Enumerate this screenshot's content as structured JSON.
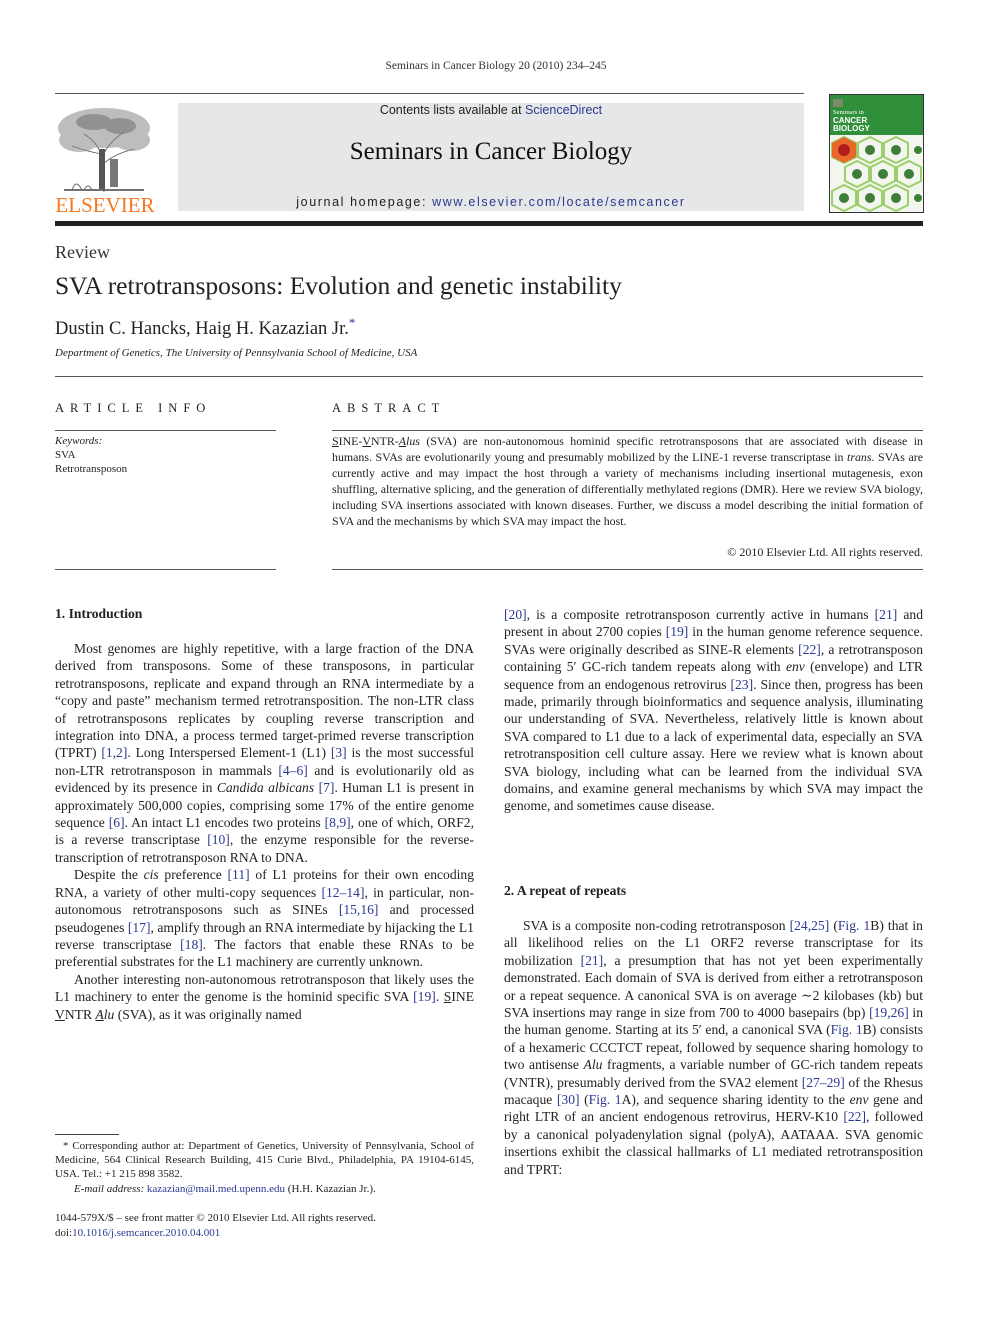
{
  "header": {
    "running_head": "Seminars in Cancer Biology 20 (2010) 234–245",
    "publisher_logo_text": "ELSEVIER",
    "contents_prefix": "Contents lists available at ",
    "contents_link": "ScienceDirect",
    "journal_name": "Seminars in Cancer Biology",
    "homepage_prefix": "journal homepage: ",
    "homepage_link": "www.elsevier.com/locate/semcancer",
    "cover": {
      "line1": "Seminars in",
      "line2": "CANCER",
      "line3": "BIOLOGY"
    }
  },
  "article": {
    "type": "Review",
    "title": "SVA retrotransposons: Evolution and genetic instability",
    "authors": "Dustin C. Hancks, Haig H. Kazazian Jr.",
    "author_mark": "*",
    "affiliation": "Department of Genetics, The University of Pennsylvania School of Medicine, USA"
  },
  "article_info": {
    "label": "ARTICLE INFO",
    "keywords_label": "Keywords:",
    "keywords": [
      "SVA",
      "Retrotransposon"
    ]
  },
  "abstract": {
    "label": "ABSTRACT",
    "p1_a": "S",
    "p1_b": "INE-",
    "p1_c": "V",
    "p1_d": "NTR-",
    "p1_e": "A",
    "p1_f": "lus",
    "p1_g": " (SVA) are non-autonomous hominid specific retrotransposons that are associated with disease in humans. SVAs are evolutionarily young and presumably mobilized by the LINE-1 reverse transcriptase in ",
    "p1_h": "trans",
    "p1_i": ". SVAs are currently active and may impact the host through a variety of mechanisms including insertional mutagenesis, exon shuffling, alternative splicing, and the generation of differentially methylated regions (DMR). Here we review SVA biology, including SVA insertions associated with known diseases. Further, we discuss a model describing the initial formation of SVA and the mechanisms by which SVA may impact the host.",
    "copyright": "© 2010 Elsevier Ltd. All rights reserved."
  },
  "sections": {
    "intro_heading": "1.  Introduction",
    "intro_p1": [
      "Most genomes are highly repetitive, with a large fraction of the DNA derived from transposons. Some of these transposons, in particular retrotransposons, replicate and expand through an RNA intermediate by a “copy and paste” mechanism termed retrotransposition. The non-LTR class of retrotransposons replicates by coupling reverse transcription and integration into DNA, a process termed target-primed reverse transcription (TPRT) ",
      "[1,2]",
      ". Long Interspersed Element-1 (L1) ",
      "[3]",
      " is the most successful non-LTR retrotransposon in mammals ",
      "[4–6]",
      " and is evolutionarily old as evidenced by its presence in ",
      "Candida albicans",
      " ",
      "[7]",
      ". Human L1 is present in approximately 500,000 copies, comprising some 17% of the entire genome sequence ",
      "[6]",
      ". An intact L1 encodes two proteins ",
      "[8,9]",
      ", one of which, ORF2, is a reverse transcriptase ",
      "[10]",
      ", the enzyme responsible for the reverse-transcription of retrotransposon RNA to DNA."
    ],
    "intro_p2": [
      "Despite the ",
      "cis",
      " preference ",
      "[11]",
      " of L1 proteins for their own encoding RNA, a variety of other multi-copy sequences ",
      "[12–14]",
      ", in particular, non-autonomous retrotransposons such as SINEs ",
      "[15,16]",
      " and processed pseudogenes ",
      "[17]",
      ", amplify through an RNA intermediate by hijacking the L1 reverse transcriptase ",
      "[18]",
      ". The factors that enable these RNAs to be preferential substrates for the L1 machinery are currently unknown."
    ],
    "intro_p3": [
      "Another interesting non-autonomous retrotransposon that likely uses the L1 machinery to enter the genome is the hominid specific SVA ",
      "[19]",
      ". ",
      "S",
      "INE ",
      "V",
      "NTR ",
      "A",
      "lu",
      " (SVA), as it was originally named"
    ],
    "intro_p3_cont": [
      "[20]",
      ", is a composite retrotransposon currently active in humans ",
      "[21]",
      " and present in about 2700 copies ",
      "[19]",
      " in the human genome reference sequence. SVAs were originally described as SINE-R elements ",
      "[22]",
      ", a retrotransposon containing 5′ GC-rich tandem repeats along with ",
      "env",
      " (envelope) and LTR sequence from an endogenous retrovirus ",
      "[23]",
      ". Since then, progress has been made, primarily through bioinformatics and sequence analysis, illuminating our understanding of SVA. Nevertheless, relatively little is known about SVA compared to L1 due to a lack of experimental data, especially an SVA retrotransposition cell culture assay. Here we review what is known about SVA biology, including what can be learned from the individual SVA domains, and examine general mechanisms by which SVA may impact the genome, and sometimes cause disease."
    ],
    "repeat_heading": "2.  A repeat of repeats",
    "repeat_p1": [
      "SVA is a composite non-coding retrotransposon ",
      "[24,25]",
      " (",
      "Fig. 1",
      "B) that in all likelihood relies on the L1 ORF2 reverse transcriptase for its mobilization ",
      "[21]",
      ", a presumption that has not yet been experimentally demonstrated. Each domain of SVA is derived from either a retrotransposon or a repeat sequence. A canonical SVA is on average ∼2 kilobases (kb) but SVA insertions may range in size from 700 to 4000 basepairs (bp) ",
      "[19,26]",
      " in the human genome. Starting at its 5′ end, a canonical SVA (",
      "Fig. 1",
      "B) consists of a hexameric CCCTCT repeat, followed by sequence sharing homology to two antisense ",
      "Alu",
      " fragments, a variable number of GC-rich tandem repeats (VNTR), presumably derived from the SVA2 element ",
      "[27–29]",
      " of the Rhesus macaque ",
      "[30]",
      " (",
      "Fig. 1",
      "A), and sequence sharing identity to the ",
      "env",
      " gene and right LTR of an ancient endogenous retrovirus, HERV-K10 ",
      "[22]",
      ", followed by a canonical polyadenylation signal (polyA), AATAAA. SVA genomic insertions exhibit the classical hallmarks of L1 mediated retrotransposition and TPRT:"
    ]
  },
  "footnotes": {
    "corresponding": "* Corresponding author at: Department of Genetics, University of Pennsylvania, School of Medicine, 564 Clinical Research Building, 415 Curie Blvd., Philadelphia, PA 19104-6145, USA. Tel.: +1 215 898 3582.",
    "email_label": "E-mail address: ",
    "email": "kazazian@mail.med.upenn.edu",
    "email_suffix": " (H.H. Kazazian Jr.).",
    "issn_line": "1044-579X/$ – see front matter © 2010 Elsevier Ltd. All rights reserved.",
    "doi_prefix": "doi:",
    "doi": "10.1016/j.semcancer.2010.04.001"
  },
  "colors": {
    "link": "#2b3990",
    "elsevier_orange": "#f47920",
    "masthead_bg": "#e6e7e8"
  }
}
